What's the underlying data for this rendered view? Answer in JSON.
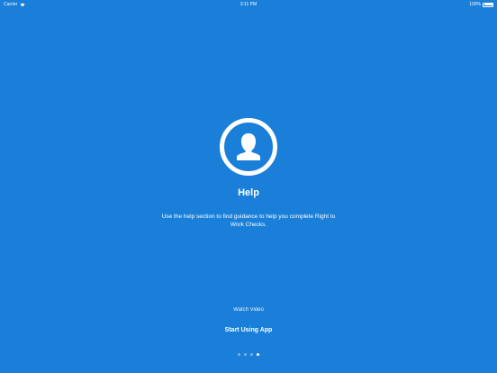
{
  "status_bar": {
    "carrier": "Carrier",
    "time": "3:11 PM",
    "battery": "100%"
  },
  "onboarding": {
    "title": "Help",
    "description": "Use the help section to find guidance to help you complete Right to Work Checks.",
    "watch_video_label": "Watch Video",
    "start_button_label": "Start Using App",
    "icon": "person-icon",
    "page_count": 4,
    "active_page": 4
  },
  "colors": {
    "background": "#1a7fd9",
    "foreground": "#ffffff"
  }
}
